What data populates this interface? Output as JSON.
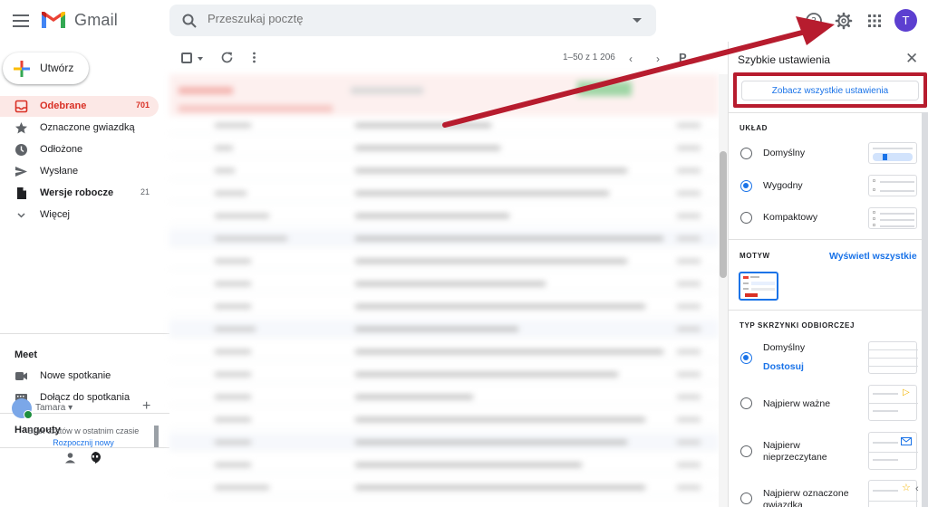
{
  "app": {
    "name": "Gmail"
  },
  "search": {
    "placeholder": "Przeszukaj pocztę"
  },
  "user": {
    "avatar_letter": "T"
  },
  "compose": {
    "label": "Utwórz"
  },
  "nav": [
    {
      "label": "Odebrane",
      "count": "701",
      "icon": "inbox-icon"
    },
    {
      "label": "Oznaczone gwiazdką",
      "count": "",
      "icon": "star-icon"
    },
    {
      "label": "Odłożone",
      "count": "",
      "icon": "clock-icon"
    },
    {
      "label": "Wysłane",
      "count": "",
      "icon": "send-icon"
    },
    {
      "label": "Wersje robocze",
      "count": "21",
      "icon": "draft-icon"
    },
    {
      "label": "Więcej",
      "count": "",
      "icon": "chevron-down-icon"
    }
  ],
  "meet": {
    "title": "Meet",
    "items": [
      {
        "label": "Nowe spotkanie",
        "icon": "video-icon"
      },
      {
        "label": "Dołącz do spotkania",
        "icon": "keyboard-icon"
      }
    ]
  },
  "hangouts": {
    "title": "Hangouty",
    "user_name": "Tamara",
    "empty_text": "Brak czatów w ostatnim czasie",
    "start_link": "Rozpocznij nowy"
  },
  "toolbar": {
    "pager": "1–50 z 1 206",
    "cut_text": "P"
  },
  "quick_settings": {
    "title": "Szybkie ustawienia",
    "see_all": "Zobacz wszystkie ustawienia",
    "layout": {
      "title": "UKŁAD",
      "options": [
        {
          "label": "Domyślny",
          "selected": false
        },
        {
          "label": "Wygodny",
          "selected": true
        },
        {
          "label": "Kompaktowy",
          "selected": false
        }
      ]
    },
    "theme": {
      "title": "MOTYW",
      "view_all": "Wyświetl wszystkie"
    },
    "inbox_type": {
      "title": "TYP SKRZYNKI ODBIORCZEJ",
      "options": [
        {
          "label": "Domyślny",
          "selected": true,
          "sub_link": "Dostosuj"
        },
        {
          "label": "Najpierw ważne",
          "selected": false
        },
        {
          "label": "Najpierw nieprzeczytane",
          "selected": false
        },
        {
          "label": "Najpierw oznaczone gwiazdką",
          "selected": false
        }
      ]
    }
  },
  "colors": {
    "accent_red": "#d93025",
    "annotation_red": "#b71c2e",
    "link_blue": "#1a73e8",
    "avatar": "#5c3fd0"
  }
}
